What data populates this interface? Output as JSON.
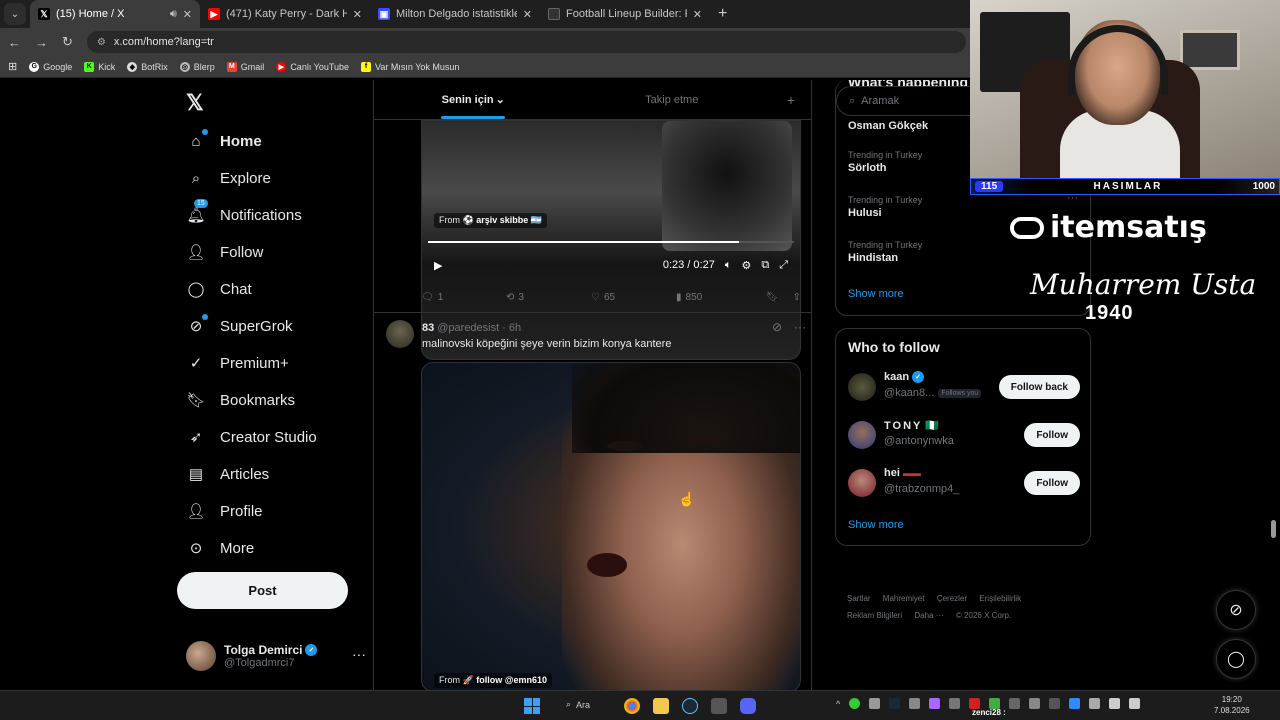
{
  "browser": {
    "tabs": [
      {
        "title": "(15) Home / X",
        "icon": "X"
      },
      {
        "title": "(471) Katy Perry - Dark Horse ft",
        "icon": "yt"
      },
      {
        "title": "Milton Delgado istatistikleri ve",
        "icon": "fm"
      },
      {
        "title": "Football Lineup Builder: Real K",
        "icon": "fl"
      }
    ],
    "url": "x.com/home?lang=tr",
    "bookmarks": [
      "Google",
      "Kick",
      "BotRix",
      "Blerp",
      "Gmail",
      "Canlı YouTube",
      "Var Mısın Yok Musun"
    ]
  },
  "nav": {
    "items": [
      {
        "label": "Home",
        "icon": "home-icon"
      },
      {
        "label": "Explore",
        "icon": "search-icon"
      },
      {
        "label": "Notifications",
        "icon": "bell-icon",
        "badge": "15"
      },
      {
        "label": "Follow",
        "icon": "add-user-icon"
      },
      {
        "label": "Chat",
        "icon": "chat-icon"
      },
      {
        "label": "SuperGrok",
        "icon": "grok-icon"
      },
      {
        "label": "Premium+",
        "icon": "premium-icon"
      },
      {
        "label": "Bookmarks",
        "icon": "bookmark-icon"
      },
      {
        "label": "Creator Studio",
        "icon": "rocket-icon"
      },
      {
        "label": "Articles",
        "icon": "article-icon"
      },
      {
        "label": "Profile",
        "icon": "person-icon"
      },
      {
        "label": "More",
        "icon": "more-circle-icon"
      }
    ],
    "post_label": "Post",
    "profile": {
      "name": "Tolga Demirci",
      "handle": "@Tolgadmrci7"
    }
  },
  "feed": {
    "tabs": [
      "Senin için",
      "Takip etme"
    ],
    "video1": {
      "from_label": "From",
      "from_name": "arşiv skibbe",
      "time": "0:23 / 0:27",
      "progress": 0.85
    },
    "post1_actions": {
      "replies": "1",
      "reposts": "3",
      "likes": "65",
      "views": "850"
    },
    "post2": {
      "name": "83",
      "handle": "@paredesist",
      "time": "· 6h",
      "text": "malinovski köpeğini şeye verin bizim konya kantere",
      "from_label": "From",
      "from_name": "follow @emn610"
    }
  },
  "sidebar": {
    "header_partial": "What's happening",
    "search_placeholder": "Aramak",
    "first_trend_partial": "Osman Gökçek",
    "trends": [
      {
        "label": "Trending in Turkey",
        "name": "Sörloth"
      },
      {
        "label": "Trending in Turkey",
        "name": "Hulusi"
      },
      {
        "label": "Trending in Turkey",
        "name": "Hindistan"
      }
    ],
    "trends_show_more": "Show more",
    "who_to_follow": {
      "title": "Who to follow",
      "users": [
        {
          "name": "kaan",
          "handle": "@kaan8...",
          "follows_you": "Follows you",
          "button": "Follow back",
          "verified": true
        },
        {
          "name": "TONY",
          "handle": "@antonynwka",
          "button": "Follow",
          "flag": "🇳🇬"
        },
        {
          "name": "hei",
          "handle": "@trabzonmp4_",
          "button": "Follow"
        }
      ],
      "show_more": "Show more"
    },
    "footer": [
      "Şartlar",
      "Mahremiyet",
      "Çerezler",
      "Erişilebilirlik",
      "Reklam Bilgileri",
      "Daha ···",
      "© 2026 X Corp."
    ]
  },
  "overlay": {
    "bar_left": "115",
    "bar_center": "HASIMLAR",
    "bar_right": "1000",
    "sponsor": "itemsatış",
    "signature": "Muharrem Usta",
    "year": "1940"
  },
  "taskbar": {
    "search_label": "Ara",
    "user_label": "zenci28 :",
    "time": "19:20",
    "date": "7.08.2026"
  },
  "colors": {
    "accent": "#1d9bf0",
    "background": "#000000",
    "text": "#e7e9ea",
    "muted": "#71767b"
  }
}
